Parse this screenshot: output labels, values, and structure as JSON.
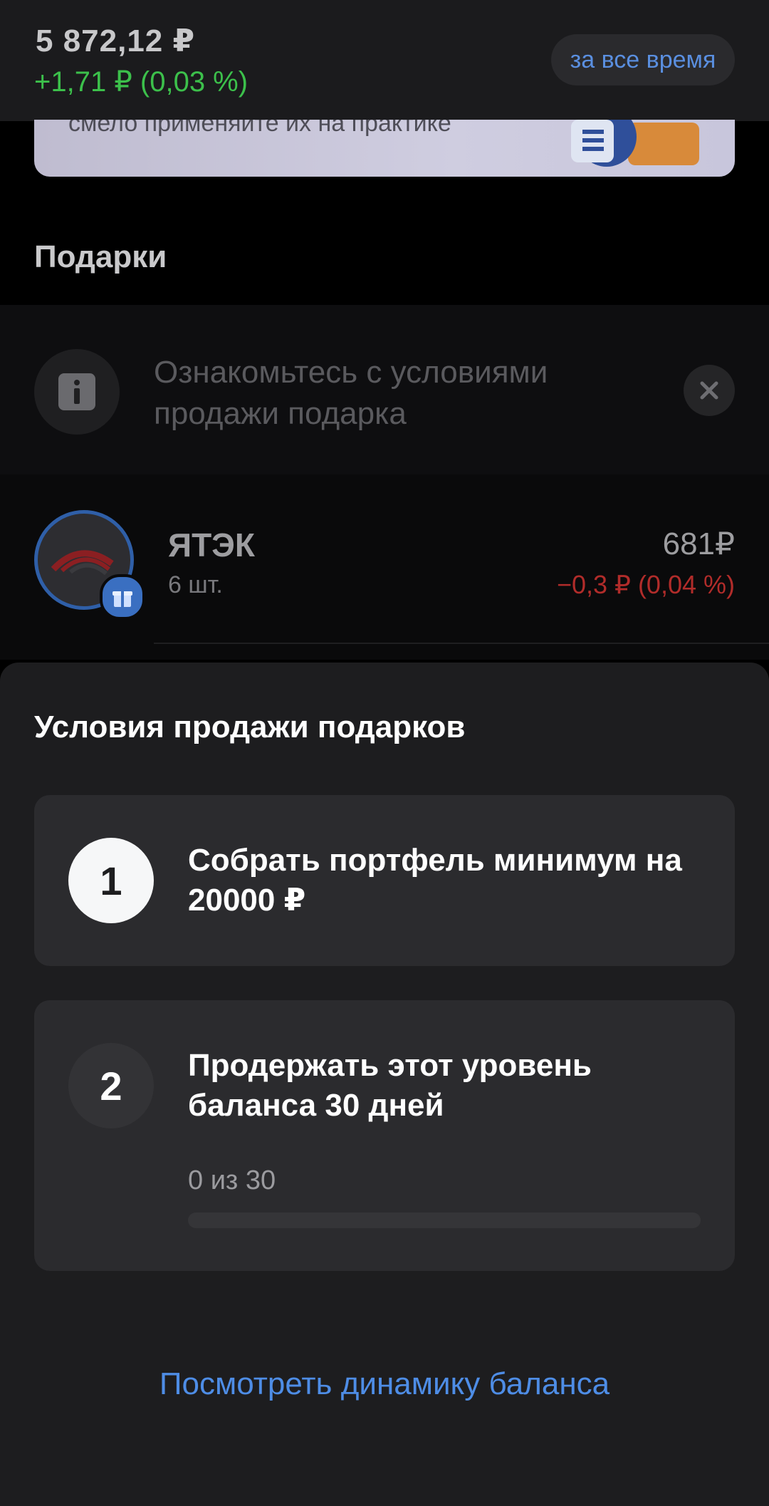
{
  "summary": {
    "balance": "5 872,12 ₽",
    "delta": "+1,71 ₽ (0,03 %)",
    "period": "за все время"
  },
  "promo": {
    "text": "смело применяйте их на практике"
  },
  "gifts_section": {
    "title": "Подарки",
    "info_text": "Ознакомьтесь с условиями продажи подарка"
  },
  "stock": {
    "name": "ЯТЭК",
    "quantity": "6 шт.",
    "price": "681₽",
    "change": "−0,3 ₽ (0,04 %)"
  },
  "sheet": {
    "title": "Условия продажи подарков",
    "conditions": [
      {
        "number": "1",
        "text": "Собрать портфель минимум на 20000 ₽"
      },
      {
        "number": "2",
        "text": "Продержать этот уровень баланса 30 дней",
        "progress_text": "0 из 30",
        "progress_value": 0,
        "progress_max": 30
      }
    ],
    "link": "Посмотреть динамику баланса"
  },
  "colors": {
    "accent": "#4e8de6",
    "positive": "#3cc04b",
    "negative": "#b12c2a"
  }
}
